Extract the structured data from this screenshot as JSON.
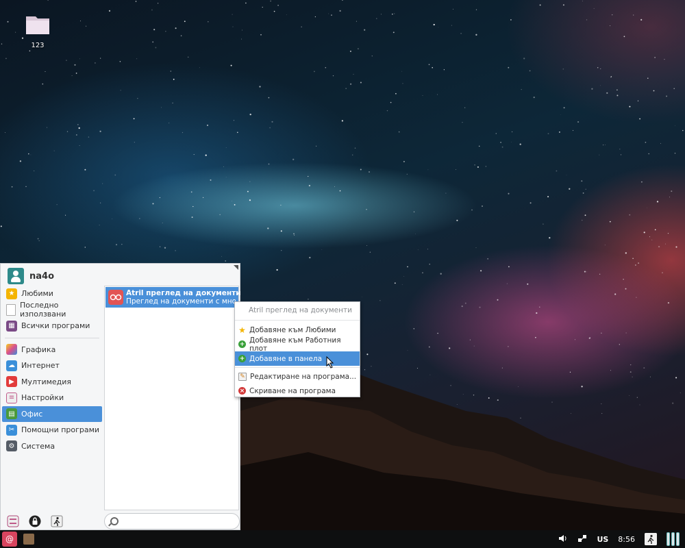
{
  "desktop": {
    "folder_label": "123"
  },
  "menu": {
    "username": "na4o",
    "categories": [
      {
        "label": "Любими",
        "icon": "star-icon",
        "color": "#f4b400"
      },
      {
        "label": "Последно използвани",
        "icon": "recent-document-icon",
        "color": "#bbbbbb"
      },
      {
        "label": "Всички програми",
        "icon": "grid-apps-icon",
        "color": "#7a4a86"
      },
      {
        "label": "Графика",
        "icon": "graphics-icon",
        "color": "#d94f8e"
      },
      {
        "label": "Интернет",
        "icon": "cloud-icon",
        "color": "#3a8fd9"
      },
      {
        "label": "Мултимедия",
        "icon": "play-icon",
        "color": "#e23b3b"
      },
      {
        "label": "Настройки",
        "icon": "settings-toggle-icon",
        "color": "#c05a8a"
      },
      {
        "label": "Офис",
        "icon": "office-icon",
        "color": "#4a9a3a"
      },
      {
        "label": "Помощни програми",
        "icon": "scissors-icon",
        "color": "#3a8fd9"
      },
      {
        "label": "Система",
        "icon": "gear-icon",
        "color": "#555c66"
      }
    ],
    "selected_category": "Офис",
    "app": {
      "title": "Atril преглед на документи",
      "description": "Преглед на документи с много ..."
    },
    "search": {
      "placeholder": ""
    }
  },
  "context_menu": {
    "header": "Atril преглед на документи",
    "items": [
      {
        "label": "Добавяне към Любими",
        "icon": "star-add-icon",
        "color": "#f4b400"
      },
      {
        "label": "Добавяне към Работния плот",
        "icon": "plus-green-icon",
        "color": "#3aa03a"
      },
      {
        "label": "Добавяне в панела",
        "icon": "plus-green-icon",
        "color": "#3aa03a"
      },
      {
        "label": "Редактиране на програма...",
        "icon": "edit-pencil-icon",
        "color": "#e0a030"
      },
      {
        "label": "Скриване на програма",
        "icon": "remove-red-icon",
        "color": "#d33a3a"
      }
    ],
    "selected_item": "Добавяне в панела"
  },
  "taskbar": {
    "keyboard_layout": "US",
    "clock": "8:56"
  }
}
